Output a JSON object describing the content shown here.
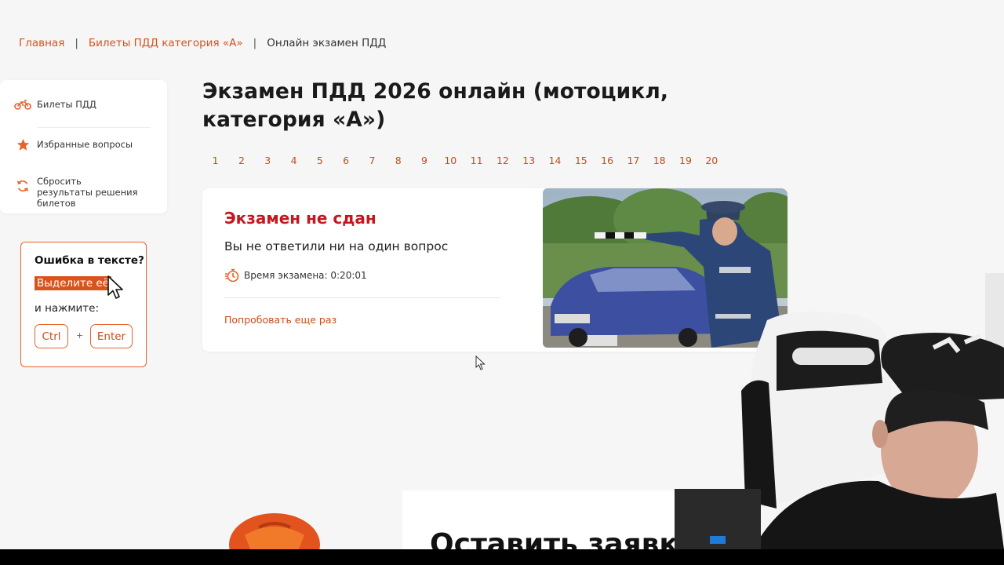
{
  "breadcrumb": {
    "home": "Главная",
    "tickets": "Билеты ПДД категория «А»",
    "current": "Онлайн экзамен ПДД",
    "separator": "|"
  },
  "sidebar": {
    "items": [
      {
        "label": "Билеты ПДД",
        "icon": "motorcycle-icon"
      },
      {
        "label": "Избранные вопросы",
        "icon": "star-icon"
      },
      {
        "label": "Сбросить результаты решения билетов",
        "icon": "refresh-icon"
      }
    ]
  },
  "error_hint": {
    "title": "Ошибка в тексте?",
    "highlight": "Выделите её",
    "press": "и нажмите:",
    "key_ctrl": "Ctrl",
    "plus": "+",
    "key_enter": "Enter"
  },
  "page": {
    "title": "Экзамен ПДД 2026 онлайн (мотоцикл, категория «А»)"
  },
  "tickets": [
    "1",
    "2",
    "3",
    "4",
    "5",
    "6",
    "7",
    "8",
    "9",
    "10",
    "11",
    "12",
    "13",
    "14",
    "15",
    "16",
    "17",
    "18",
    "19",
    "20"
  ],
  "result": {
    "title": "Экзамен не сдан",
    "subtitle": "Вы не ответили ни на один вопрос",
    "time_label": "Время экзамена: 0:20:01",
    "retry": "Попробовать еще раз",
    "photo_icon": "traffic-police-photo"
  },
  "request": {
    "title": "Оставить заявку"
  },
  "colors": {
    "accent": "#d4531c",
    "fail_red": "#c4181e",
    "background": "#f6f6f6"
  }
}
